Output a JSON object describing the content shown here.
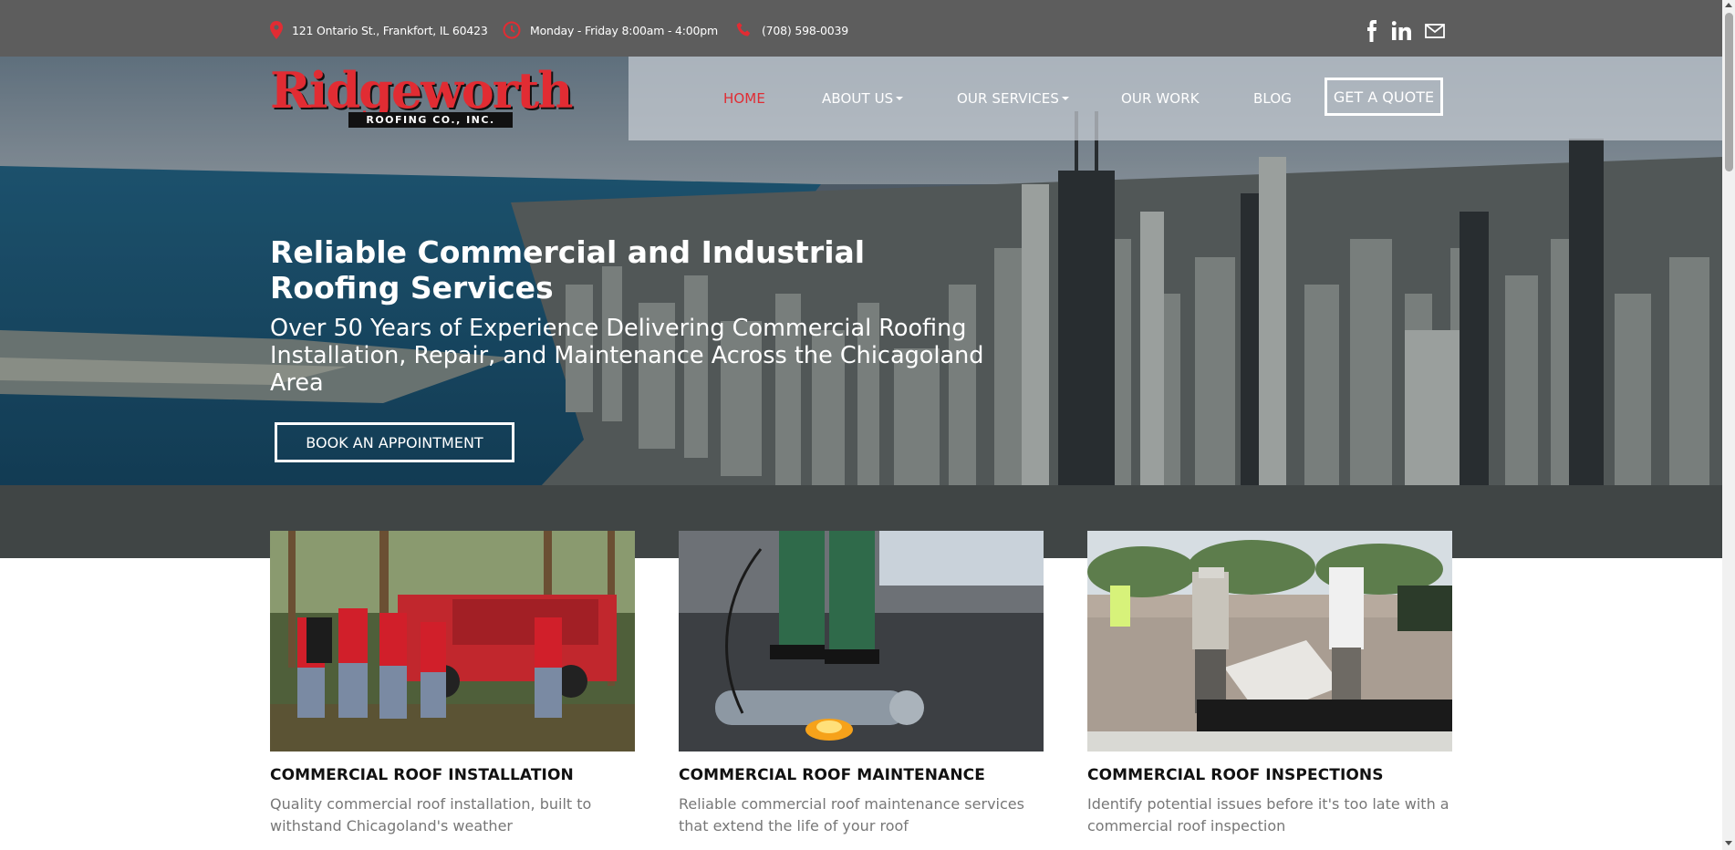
{
  "topbar": {
    "address": "121 Ontario St., Frankfort, IL 60423",
    "hours": "Monday - Friday 8:00am - 4:00pm",
    "phone": "(708) 598-0039",
    "icons": [
      "location-pin-icon",
      "clock-icon",
      "phone-icon",
      "facebook-icon",
      "linkedin-icon",
      "mail-icon"
    ]
  },
  "logo": {
    "name": "Ridgeworth",
    "subtitle": "ROOFING CO., INC."
  },
  "nav": {
    "home": "HOME",
    "about": "ABOUT US",
    "services": "OUR SERVICES",
    "work": "OUR WORK",
    "blog": "BLOG",
    "quote": "GET A QUOTE"
  },
  "hero": {
    "title": "Reliable Commercial and Industrial Roofing Services",
    "subtitle": "Over 50 Years of Experience Delivering Commercial Roofing Installation, Repair, and Maintenance Across the Chicagoland Area",
    "cta": "BOOK AN APPOINTMENT"
  },
  "cards": [
    {
      "title": "COMMERCIAL ROOF INSTALLATION",
      "desc": "Quality commercial roof installation, built to withstand Chicagoland's weather"
    },
    {
      "title": "COMMERCIAL ROOF MAINTENANCE",
      "desc": "Reliable commercial roof maintenance services that extend the life of your roof"
    },
    {
      "title": "COMMERCIAL ROOF INSPECTIONS",
      "desc": "Identify potential issues before it's too late with a commercial roof inspection"
    }
  ],
  "colors": {
    "brand_red": "#e12c33",
    "topbar": "#5d5d5d",
    "nav_panel": "#c8cdd4"
  }
}
